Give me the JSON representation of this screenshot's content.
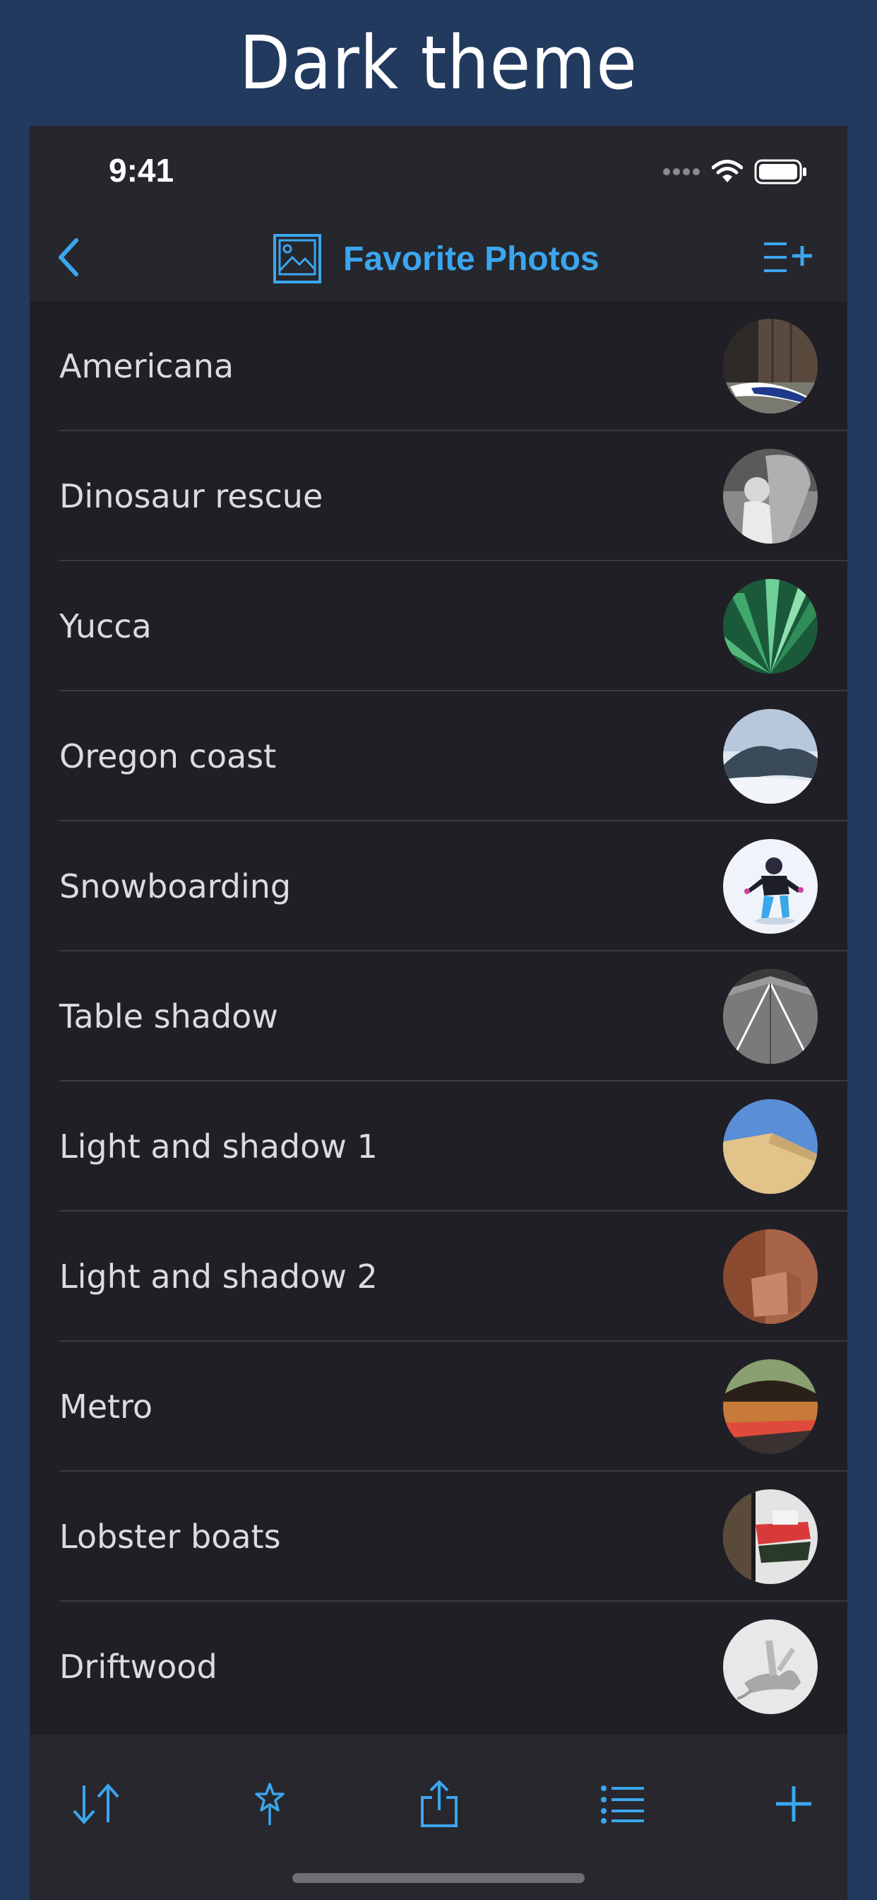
{
  "banner": {
    "title": "Dark theme"
  },
  "status_bar": {
    "time": "9:41"
  },
  "nav": {
    "title": "Favorite Photos"
  },
  "colors": {
    "accent": "#3ba6ee",
    "background": "#201f26",
    "bar": "#26262d",
    "outer": "#223a5e"
  },
  "items": [
    {
      "label": "Americana",
      "thumb": "americana"
    },
    {
      "label": "Dinosaur rescue",
      "thumb": "dinosaur"
    },
    {
      "label": "Yucca",
      "thumb": "yucca"
    },
    {
      "label": "Oregon coast",
      "thumb": "coast"
    },
    {
      "label": "Snowboarding",
      "thumb": "snow"
    },
    {
      "label": "Table shadow",
      "thumb": "table"
    },
    {
      "label": "Light and shadow 1",
      "thumb": "light1"
    },
    {
      "label": "Light and shadow 2",
      "thumb": "light2"
    },
    {
      "label": "Metro",
      "thumb": "metro"
    },
    {
      "label": "Lobster boats",
      "thumb": "boats"
    },
    {
      "label": "Driftwood",
      "thumb": "driftwood"
    }
  ],
  "toolbar": {
    "buttons": [
      "sort-icon",
      "pin-icon",
      "share-icon",
      "list-icon",
      "plus-icon"
    ]
  }
}
